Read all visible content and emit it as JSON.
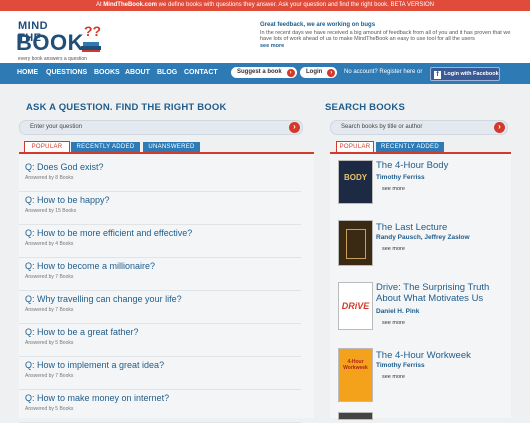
{
  "topbar": {
    "prefix": "At",
    "site": "MindTheBook.com",
    "text": "we define books with questions they answer. Ask your question and find the right book. BETA VERSION"
  },
  "logo": {
    "mind": "MIND THE",
    "book": "BOOK",
    "tagline": "every book answers a question",
    "mark": "??"
  },
  "news": {
    "title": "Great feedback, we are working on bugs",
    "body": "In the recent days we have received a big amount of feedback from all of you and it has proven that we have lots of work ahead of us to make MindTheBook an easy to use tool for all the users",
    "more": "see more"
  },
  "nav": {
    "items": [
      "HOME",
      "QUESTIONS",
      "BOOKS",
      "ABOUT",
      "BLOG",
      "CONTACT"
    ],
    "suggest": "Suggest a book",
    "login": "Login",
    "no_account": "No account? Register here or",
    "facebook": "Login with Facebook",
    "arrow": "›"
  },
  "ask": {
    "title": "ASK A QUESTION. FIND THE RIGHT BOOK",
    "placeholder": "Enter your question",
    "tabs": [
      "POPULAR",
      "RECENTLY ADDED",
      "UNANSWERED"
    ],
    "questions": [
      {
        "title": "Q: Does God exist?",
        "answered": "Answered by 8 Books"
      },
      {
        "title": "Q: How to be happy?",
        "answered": "Answered by 15 Books"
      },
      {
        "title": "Q: How to be more efficient and effective?",
        "answered": "Answered by 4 Books"
      },
      {
        "title": "Q: How to become a millionaire?",
        "answered": "Answered by 7 Books"
      },
      {
        "title": "Q: Why travelling can change your life?",
        "answered": "Answered by 7 Books"
      },
      {
        "title": "Q: How to be a great father?",
        "answered": "Answered by 5 Books"
      },
      {
        "title": "Q: How to implement a great idea?",
        "answered": "Answered by 7 Books"
      },
      {
        "title": "Q: How to make money on internet?",
        "answered": "Answered by 5 Books"
      }
    ]
  },
  "search": {
    "title": "SEARCH BOOKS",
    "placeholder": "Search books by title or author",
    "tabs": [
      "POPULAR",
      "RECENTLY ADDED"
    ],
    "books": [
      {
        "title": "The 4-Hour Body",
        "author": "Timothy Ferriss",
        "more": "see more",
        "cover_color": "#1d2a44",
        "cover_text": "BODY"
      },
      {
        "title": "The Last Lecture",
        "author": "Randy Pausch, Jeffrey Zaslow",
        "more": "see more",
        "cover_color": "#3a2a14",
        "cover_text": ""
      },
      {
        "title": "Drive: The Surprising Truth About What Motivates Us",
        "author": "Daniel H. Pink",
        "more": "see more",
        "cover_color": "#ffffff",
        "cover_text": "DRiVE"
      },
      {
        "title": "The 4-Hour Workweek",
        "author": "Timothy Ferriss",
        "more": "see more",
        "cover_color": "#f4a21c",
        "cover_text": "4-Hour Workweek"
      }
    ]
  },
  "colors": {
    "brand_blue": "#1f5d8c",
    "nav_blue": "#2e7ab5",
    "accent_red": "#d33a2c"
  }
}
